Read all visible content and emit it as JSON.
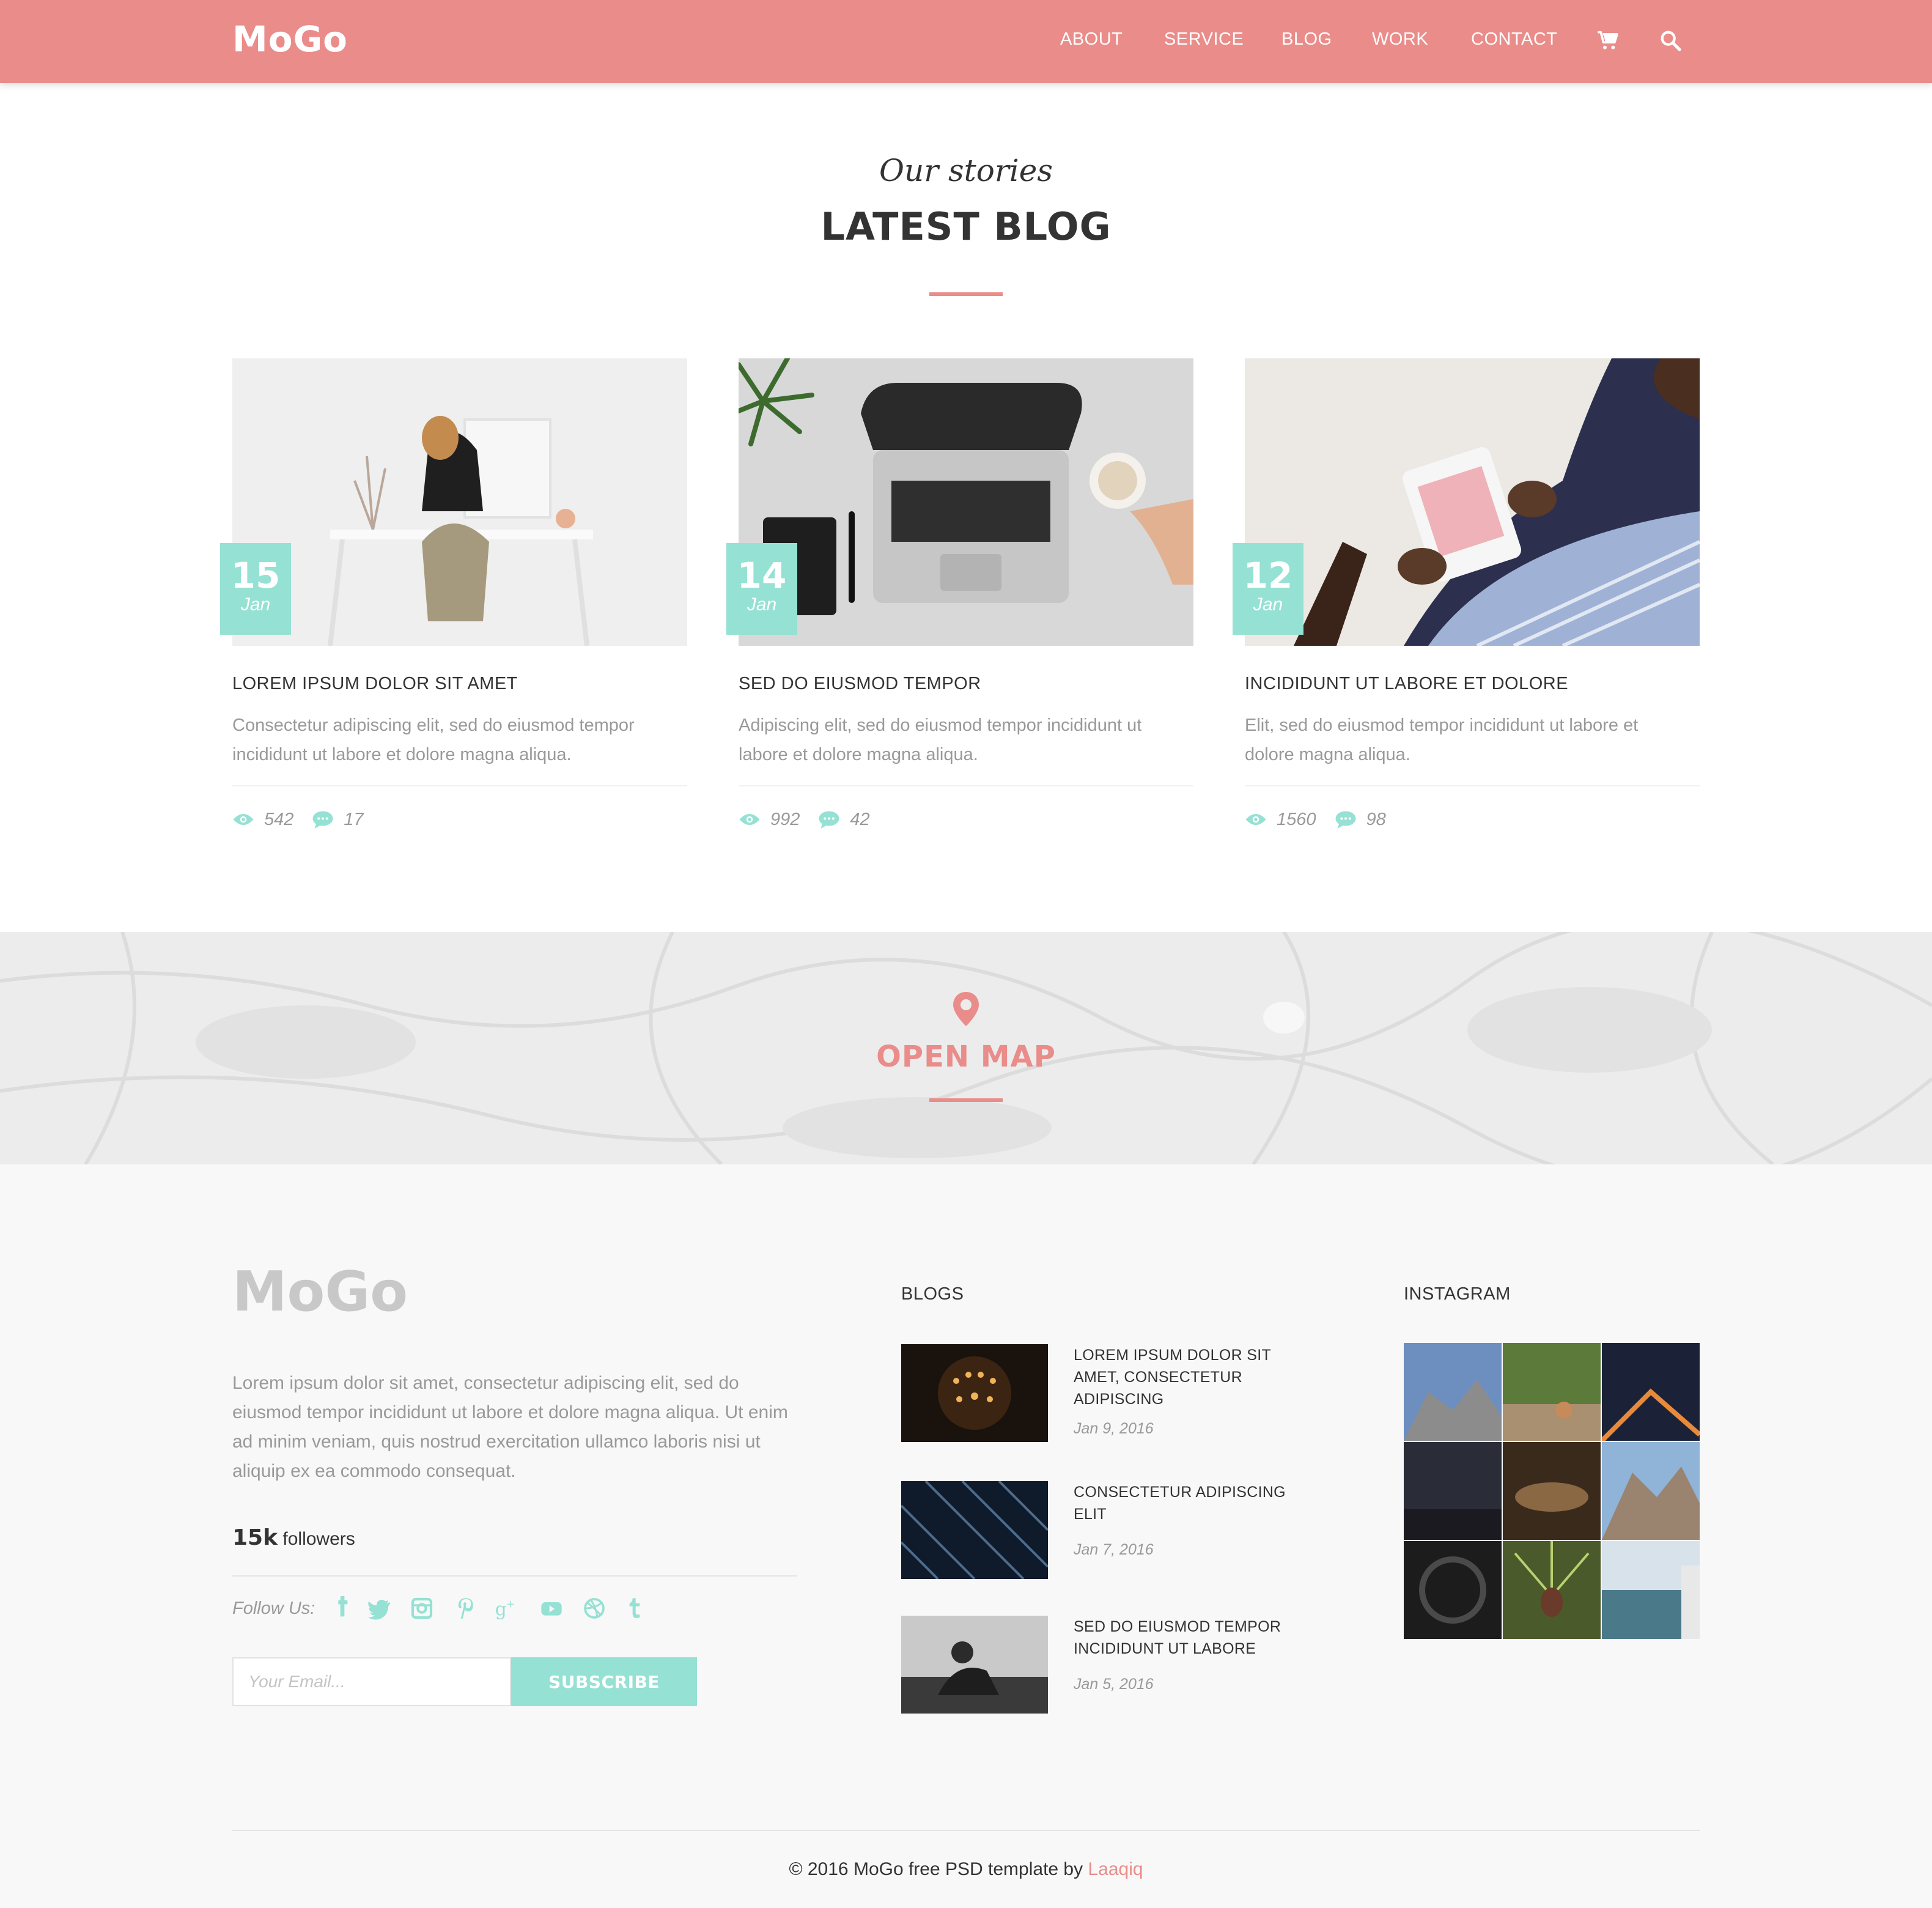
{
  "brand": {
    "logo": "MoGo",
    "accent": "#e98c8a",
    "mint": "#95e1d3"
  },
  "nav": {
    "items": [
      "ABOUT",
      "SERVICE",
      "BLOG",
      "WORK",
      "CONTACT"
    ],
    "icons": [
      "cart-icon",
      "search-icon"
    ]
  },
  "section": {
    "subtitle": "Our stories",
    "title": "LATEST BLOG"
  },
  "posts": [
    {
      "day": "15",
      "month": "Jan",
      "title": "LOREM IPSUM DOLOR SIT AMET",
      "text": "Consectetur adipiscing elit, sed do eiusmod tempor incididunt ut labore et dolore magna aliqua.",
      "views": "542",
      "comments": "17"
    },
    {
      "day": "14",
      "month": "Jan",
      "title": "SED DO EIUSMOD TEMPOR",
      "text": "Adipiscing elit, sed do eiusmod tempor incididunt ut labore et dolore magna aliqua.",
      "views": "992",
      "comments": "42"
    },
    {
      "day": "12",
      "month": "Jan",
      "title": "INCIDIDUNT UT LABORE ET DOLORE",
      "text": "Elit, sed do eiusmod tempor incididunt ut labore et dolore magna aliqua.",
      "views": "1560",
      "comments": "98"
    }
  ],
  "map": {
    "label": "OPEN MAP",
    "icon": "map-pin-icon"
  },
  "footer": {
    "logo": "MoGo",
    "about": "Lorem ipsum dolor sit amet, consectetur adipiscing elit, sed do eiusmod tempor incididunt ut labore et dolore magna aliqua. Ut enim ad minim veniam, quis nostrud exercitation ullamco laboris nisi ut aliquip ex ea commodo consequat.",
    "followers_count": "15k",
    "followers_label": "followers",
    "follow_us": "Follow Us:",
    "social": [
      "facebook-icon",
      "twitter-icon",
      "instagram-icon",
      "pinterest-icon",
      "google-plus-icon",
      "youtube-icon",
      "dribbble-icon",
      "tumblr-icon"
    ],
    "email_placeholder": "Your Email...",
    "subscribe": "SUBSCRIBE",
    "blogs_title": "BLOGS",
    "blogs": [
      {
        "title": "LOREM IPSUM DOLOR SIT AMET, CONSECTETUR ADIPISCING",
        "date": "Jan 9, 2016"
      },
      {
        "title": "CONSECTETUR ADIPISCING ELIT",
        "date": "Jan 7, 2016"
      },
      {
        "title": "SED DO EIUSMOD TEMPOR INCIDIDUNT UT LABORE",
        "date": "Jan 5, 2016"
      }
    ],
    "instagram_title": "INSTAGRAM",
    "copyright_prefix": "© 2016 MoGo free PSD template by",
    "copyright_author": "Laaqiq"
  }
}
